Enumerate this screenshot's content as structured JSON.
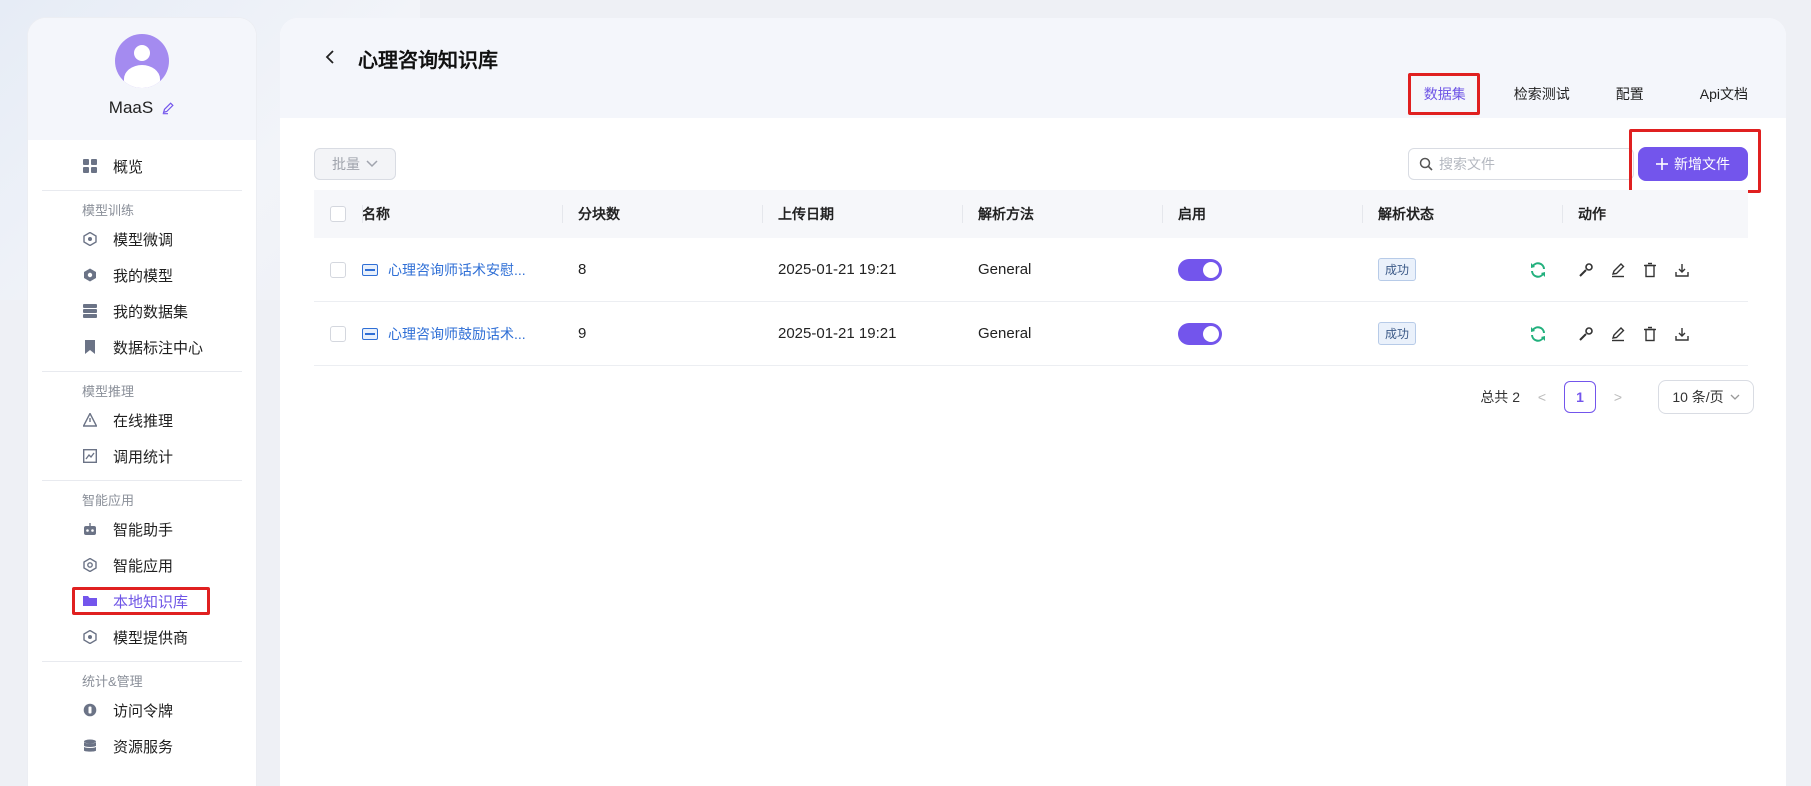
{
  "user": {
    "name": "MaaS"
  },
  "sidebar": {
    "overview": "概览",
    "groups": [
      {
        "title": "模型训练",
        "items": [
          "模型微调",
          "我的模型",
          "我的数据集",
          "数据标注中心"
        ]
      },
      {
        "title": "模型推理",
        "items": [
          "在线推理",
          "调用统计"
        ]
      },
      {
        "title": "智能应用",
        "items": [
          "智能助手",
          "智能应用",
          "本地知识库",
          "模型提供商"
        ]
      },
      {
        "title": "统计&管理",
        "items": [
          "访问令牌",
          "资源服务"
        ]
      }
    ]
  },
  "header": {
    "title": "心理咨询知识库",
    "tabs": [
      "数据集",
      "检索测试",
      "配置",
      "Api文档"
    ],
    "active_tab": "数据集"
  },
  "toolbar": {
    "batch_label": "批量",
    "search_placeholder": "搜索文件",
    "add_label": "新增文件"
  },
  "table": {
    "columns": [
      "名称",
      "分块数",
      "上传日期",
      "解析方法",
      "启用",
      "解析状态",
      "动作"
    ],
    "rows": [
      {
        "name": "心理咨询师话术安慰...",
        "chunks": "8",
        "date": "2025-01-21 19:21",
        "method": "General",
        "enabled": true,
        "status": "成功"
      },
      {
        "name": "心理咨询师鼓励话术...",
        "chunks": "9",
        "date": "2025-01-21 19:21",
        "method": "General",
        "enabled": true,
        "status": "成功"
      }
    ]
  },
  "pagination": {
    "total_label": "总共 2",
    "current_page": "1",
    "page_size": "10 条/页"
  },
  "colors": {
    "accent": "#7355ec",
    "highlight": "#e02020",
    "link": "#2f6fd6",
    "success_icon": "#22b07d"
  }
}
